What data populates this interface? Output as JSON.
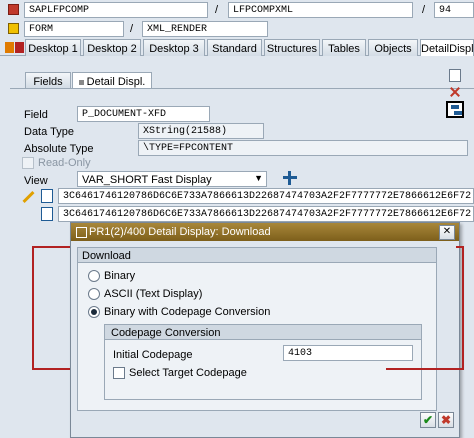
{
  "top": {
    "program": "SAPLFPCOMP",
    "sep1": "/",
    "include": "LFPCOMPXML",
    "sep2": "/",
    "line": "94",
    "type": "FORM",
    "sep3": "/",
    "form": "XML_RENDER"
  },
  "desktop_tabs": [
    "Desktop 1",
    "Desktop 2",
    "Desktop 3",
    "Standard",
    "Structures",
    "Tables",
    "Objects",
    "DetailDisplay"
  ],
  "inner_tabs": [
    "Fields",
    "Detail Displ."
  ],
  "labels": {
    "field": "Field",
    "data_type": "Data Type",
    "absolute_type": "Absolute Type",
    "read_only": "Read-Only",
    "view": "View"
  },
  "values": {
    "field": "P_DOCUMENT-XFD",
    "data_type": "XString(21588)",
    "absolute_type": "\\TYPE=FPCONTENT",
    "view": "VAR_SHORT Fast Display",
    "hex1": "3C6461746120786D6C6E733A7866613D22687474703A2F2F7777772E7866612E6F72",
    "hex2": "3C6461746120786D6C6E733A7866613D22687474703A2F2F7777772E7866612E6F72"
  },
  "dialog": {
    "title": "PR1(2)/400 Detail Display: Download",
    "group_download": "Download",
    "opt_binary": "Binary",
    "opt_ascii": "ASCII (Text Display)",
    "opt_binary_cp": "Binary with Codepage Conversion",
    "group_codepage": "Codepage Conversion",
    "initial_codepage_label": "Initial Codepage",
    "initial_codepage_value": "4103",
    "select_target": "Select Target Codepage",
    "selected_option": "binary_cp"
  },
  "colors": {
    "dialog_title": "#8a6a1f",
    "accent_orange": "#e07b00",
    "bg": "#dfe6ee",
    "red_line": "#b22222"
  }
}
